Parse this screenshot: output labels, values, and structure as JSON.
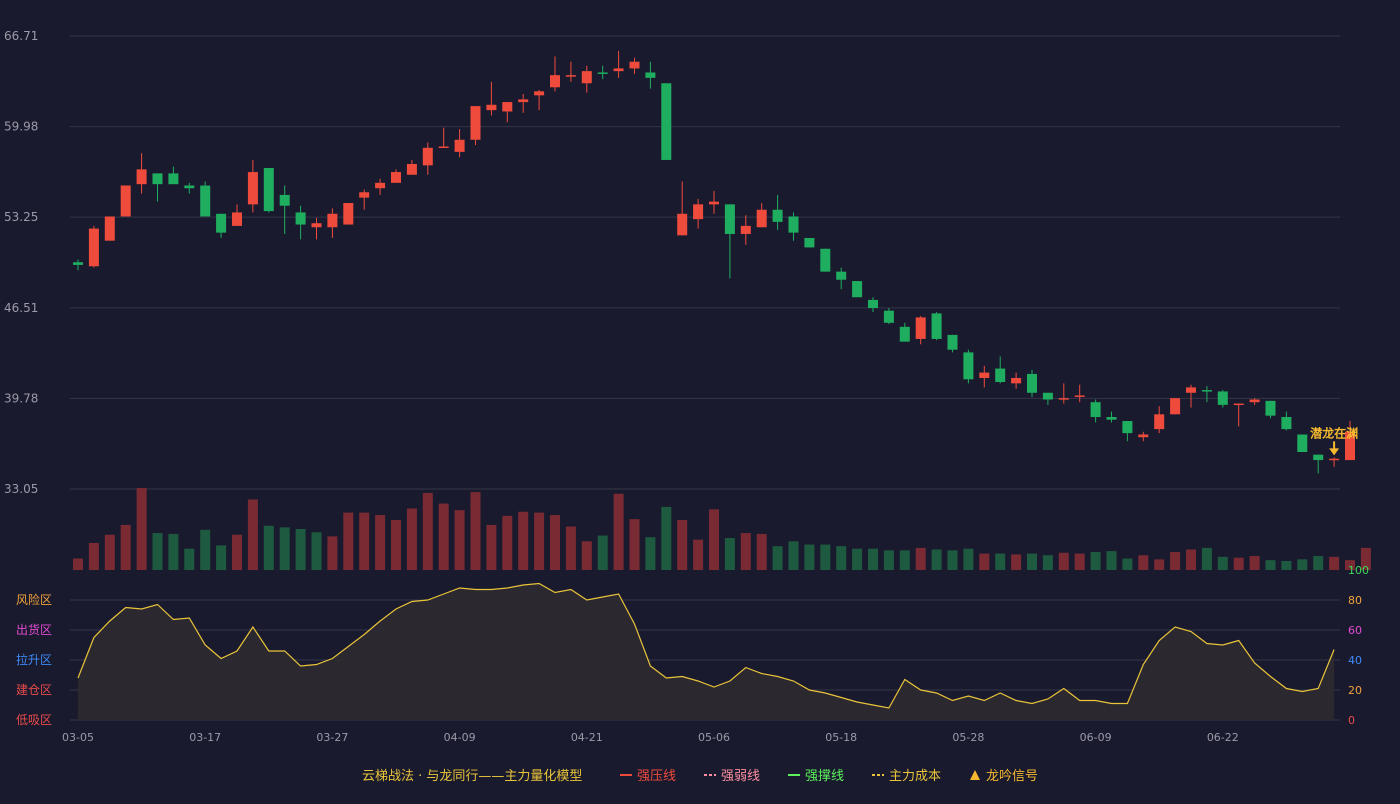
{
  "chart_data": {
    "type": "candlestick",
    "colors": {
      "background": "#1a1a2e",
      "up": "#ef4b3c",
      "down": "#1fae5f",
      "volume_up": "#7a2a33",
      "volume_down": "#1d5a40",
      "grid": "#353548",
      "axis_text": "#9a9aa8",
      "indicator_line": "#e9c43a",
      "indicator_fill": "#2d2a30",
      "signal": "#f5b82e"
    },
    "price_axis": {
      "ticks": [
        33.05,
        39.78,
        46.51,
        53.25,
        59.98,
        66.71
      ],
      "labels": [
        "33.05",
        "39.78",
        "46.51",
        "53.25",
        "59.98",
        "66.71"
      ],
      "ylim": [
        33.05,
        66.71
      ]
    },
    "x_tick_labels": [
      {
        "index": 0,
        "label": "03-05"
      },
      {
        "index": 8,
        "label": "03-17"
      },
      {
        "index": 16,
        "label": "03-27"
      },
      {
        "index": 24,
        "label": "04-09"
      },
      {
        "index": 32,
        "label": "04-21"
      },
      {
        "index": 40,
        "label": "05-06"
      },
      {
        "index": 48,
        "label": "05-18"
      },
      {
        "index": 56,
        "label": "05-28"
      },
      {
        "index": 64,
        "label": "06-09"
      },
      {
        "index": 72,
        "label": "06-22"
      }
    ],
    "candles": [
      [
        49.9,
        49.7,
        50.1,
        49.3
      ],
      [
        49.6,
        52.4,
        52.6,
        49.5
      ],
      [
        51.5,
        53.3,
        53.3,
        51.5
      ],
      [
        53.3,
        55.6,
        55.6,
        53.3
      ],
      [
        55.7,
        56.8,
        58.0,
        55.0
      ],
      [
        56.5,
        55.7,
        56.5,
        54.4
      ],
      [
        56.5,
        55.7,
        57.0,
        55.7
      ],
      [
        55.6,
        55.4,
        55.8,
        55.0
      ],
      [
        55.6,
        53.3,
        55.9,
        53.3
      ],
      [
        53.5,
        52.1,
        53.5,
        51.7
      ],
      [
        52.6,
        53.6,
        54.2,
        52.6
      ],
      [
        54.2,
        56.6,
        57.5,
        53.6
      ],
      [
        56.9,
        53.7,
        56.9,
        53.6
      ],
      [
        54.9,
        54.1,
        55.6,
        52.0
      ],
      [
        53.6,
        52.7,
        54.1,
        51.6
      ],
      [
        52.5,
        52.8,
        53.2,
        51.6
      ],
      [
        52.5,
        53.5,
        53.9,
        51.7
      ],
      [
        52.7,
        54.3,
        54.3,
        52.7
      ],
      [
        54.7,
        55.1,
        55.3,
        53.8
      ],
      [
        55.4,
        55.8,
        56.1,
        54.9
      ],
      [
        55.8,
        56.6,
        56.8,
        55.8
      ],
      [
        56.4,
        57.2,
        57.5,
        56.4
      ],
      [
        57.1,
        58.4,
        58.8,
        56.4
      ],
      [
        58.5,
        58.5,
        59.9,
        58.5
      ],
      [
        58.1,
        59.0,
        59.8,
        57.7
      ],
      [
        59.0,
        61.5,
        61.5,
        58.6
      ],
      [
        61.2,
        61.6,
        63.3,
        60.8
      ],
      [
        61.1,
        61.8,
        61.8,
        60.3
      ],
      [
        61.8,
        62.0,
        62.4,
        61.0
      ],
      [
        62.3,
        62.6,
        62.7,
        61.2
      ],
      [
        62.9,
        63.8,
        65.2,
        62.6
      ],
      [
        63.7,
        63.8,
        64.8,
        63.3
      ],
      [
        63.2,
        64.1,
        64.5,
        62.5
      ],
      [
        64.0,
        63.9,
        64.5,
        63.5
      ],
      [
        64.1,
        64.3,
        65.6,
        63.6
      ],
      [
        64.3,
        64.8,
        65.1,
        63.9
      ],
      [
        64.0,
        63.6,
        64.8,
        62.8
      ],
      [
        63.2,
        57.5,
        63.2,
        57.5
      ],
      [
        51.9,
        53.5,
        55.9,
        51.9
      ],
      [
        53.1,
        54.2,
        54.6,
        52.4
      ],
      [
        54.2,
        54.4,
        55.2,
        53.5
      ],
      [
        54.2,
        52.0,
        54.2,
        48.7
      ],
      [
        52.0,
        52.6,
        53.4,
        51.2
      ],
      [
        52.5,
        53.8,
        54.3,
        52.5
      ],
      [
        53.8,
        52.9,
        54.9,
        52.3
      ],
      [
        53.3,
        52.1,
        53.6,
        51.5
      ],
      [
        51.7,
        51.0,
        51.7,
        51.0
      ],
      [
        50.9,
        49.2,
        50.9,
        49.2
      ],
      [
        49.2,
        48.6,
        49.5,
        47.9
      ],
      [
        48.5,
        47.3,
        48.5,
        47.3
      ],
      [
        47.1,
        46.5,
        47.3,
        46.2
      ],
      [
        46.3,
        45.4,
        46.5,
        45.3
      ],
      [
        45.1,
        44.0,
        45.4,
        44.0
      ],
      [
        44.2,
        45.8,
        45.9,
        43.8
      ],
      [
        46.1,
        44.2,
        46.2,
        44.1
      ],
      [
        44.5,
        43.4,
        44.5,
        43.2
      ],
      [
        43.2,
        41.2,
        43.4,
        40.9
      ],
      [
        41.3,
        41.7,
        42.2,
        40.6
      ],
      [
        42.0,
        41.0,
        42.9,
        40.9
      ],
      [
        40.9,
        41.3,
        41.7,
        40.5
      ],
      [
        41.6,
        40.2,
        41.9,
        39.9
      ],
      [
        40.2,
        39.7,
        40.2,
        39.3
      ],
      [
        39.7,
        39.8,
        40.9,
        39.4
      ],
      [
        39.9,
        40.0,
        40.8,
        39.5
      ],
      [
        39.5,
        38.4,
        39.7,
        38.0
      ],
      [
        38.4,
        38.2,
        38.8,
        38.0
      ],
      [
        38.1,
        37.2,
        38.1,
        36.6
      ],
      [
        36.9,
        37.1,
        37.3,
        36.6
      ],
      [
        37.5,
        38.6,
        39.2,
        37.2
      ],
      [
        38.6,
        39.8,
        39.8,
        38.6
      ],
      [
        40.2,
        40.6,
        40.8,
        39.1
      ],
      [
        40.4,
        40.3,
        40.7,
        39.5
      ],
      [
        40.3,
        39.3,
        40.4,
        39.1
      ],
      [
        39.3,
        39.4,
        39.4,
        37.7
      ],
      [
        39.5,
        39.7,
        39.8,
        39.3
      ],
      [
        39.6,
        38.5,
        39.6,
        38.3
      ],
      [
        38.4,
        37.5,
        38.8,
        37.4
      ],
      [
        37.1,
        35.8,
        37.1,
        35.8
      ],
      [
        35.6,
        35.2,
        35.6,
        34.2
      ],
      [
        35.2,
        35.3,
        35.4,
        34.7
      ],
      [
        35.2,
        37.3,
        38.1,
        35.2
      ]
    ],
    "volume": [
      14,
      33,
      43,
      55,
      100,
      45,
      44,
      26,
      49,
      30,
      43,
      86,
      54,
      52,
      50,
      46,
      41,
      70,
      70,
      67,
      61,
      75,
      94,
      81,
      73,
      95,
      55,
      66,
      71,
      70,
      67,
      53,
      35,
      42,
      93,
      62,
      40,
      77,
      61,
      37,
      74,
      39,
      45,
      44,
      29,
      35,
      31,
      31,
      29,
      26,
      26,
      24,
      24,
      27,
      25,
      24,
      26,
      20,
      20,
      19,
      20,
      18,
      21,
      20,
      22,
      23,
      14,
      18,
      13,
      22,
      25,
      27,
      16,
      15,
      17,
      12,
      11,
      13,
      17,
      16,
      12,
      27
    ],
    "volume_up": [
      1,
      1,
      1,
      1,
      1,
      0,
      0,
      0,
      0,
      0,
      1,
      1,
      0,
      0,
      0,
      0,
      1,
      1,
      1,
      1,
      1,
      1,
      1,
      1,
      1,
      1,
      1,
      1,
      1,
      1,
      1,
      1,
      1,
      0,
      1,
      1,
      0,
      0,
      1,
      1,
      1,
      0,
      1,
      1,
      0,
      0,
      0,
      0,
      0,
      0,
      0,
      0,
      0,
      1,
      0,
      0,
      0,
      1,
      0,
      1,
      0,
      0,
      1,
      1,
      0,
      0,
      0,
      1,
      1,
      1,
      1,
      0,
      0,
      1,
      1,
      0,
      0,
      0,
      0,
      1,
      1,
      1
    ],
    "indicator": [
      28,
      55,
      66,
      75,
      74,
      77,
      67,
      68,
      50,
      41,
      46,
      62,
      46,
      46,
      36,
      37,
      41,
      49,
      57,
      66,
      74,
      79,
      80,
      84,
      88,
      87,
      87,
      88,
      90,
      91,
      85,
      87,
      80,
      82,
      84,
      64,
      36,
      28,
      29,
      26,
      22,
      26,
      35,
      31,
      29,
      26,
      20,
      18,
      15,
      12,
      10,
      8,
      27,
      20,
      18,
      13,
      16,
      13,
      18,
      13,
      11,
      14,
      21,
      13,
      13,
      11,
      11,
      37,
      53,
      62,
      59,
      51,
      50,
      53,
      38,
      29,
      21,
      19,
      21,
      47
    ],
    "indicator_axis": {
      "ticks": [
        0,
        20,
        40,
        60,
        80,
        100
      ],
      "labels": [
        "0",
        "20",
        "40",
        "60",
        "80",
        "100"
      ]
    },
    "indicator_tick_colors": [
      "#e84b4b",
      "#f0a23c",
      "#3d8af7",
      "#e04bd2",
      "#f0a23c",
      "#3adb5a"
    ],
    "zones": [
      {
        "label": "风险区",
        "level": 80,
        "color": "#f0a23c"
      },
      {
        "label": "出货区",
        "level": 60,
        "color": "#e04bd2"
      },
      {
        "label": "拉升区",
        "level": 40,
        "color": "#3d8af7"
      },
      {
        "label": "建仓区",
        "level": 20,
        "color": "#e84b4b"
      },
      {
        "label": "低吸区",
        "level": 0,
        "color": "#e84b4b"
      }
    ],
    "signal_annotation": {
      "text": "潜龙在渊",
      "index": 79
    },
    "legend": [
      {
        "label": "云梯战法 · 与龙同行——主力量化模型",
        "style": "title",
        "color": "#e9c43a"
      },
      {
        "label": "强压线",
        "style": "solid",
        "color": "#ef4b3c"
      },
      {
        "label": "强弱线",
        "style": "dashed",
        "color": "#ff8fa0"
      },
      {
        "label": "强撑线",
        "style": "solid",
        "color": "#5cf05c"
      },
      {
        "label": "主力成本",
        "style": "dashed",
        "color": "#e9c43a"
      },
      {
        "label": "龙吟信号",
        "style": "triangle",
        "color": "#f5b82e"
      }
    ]
  }
}
